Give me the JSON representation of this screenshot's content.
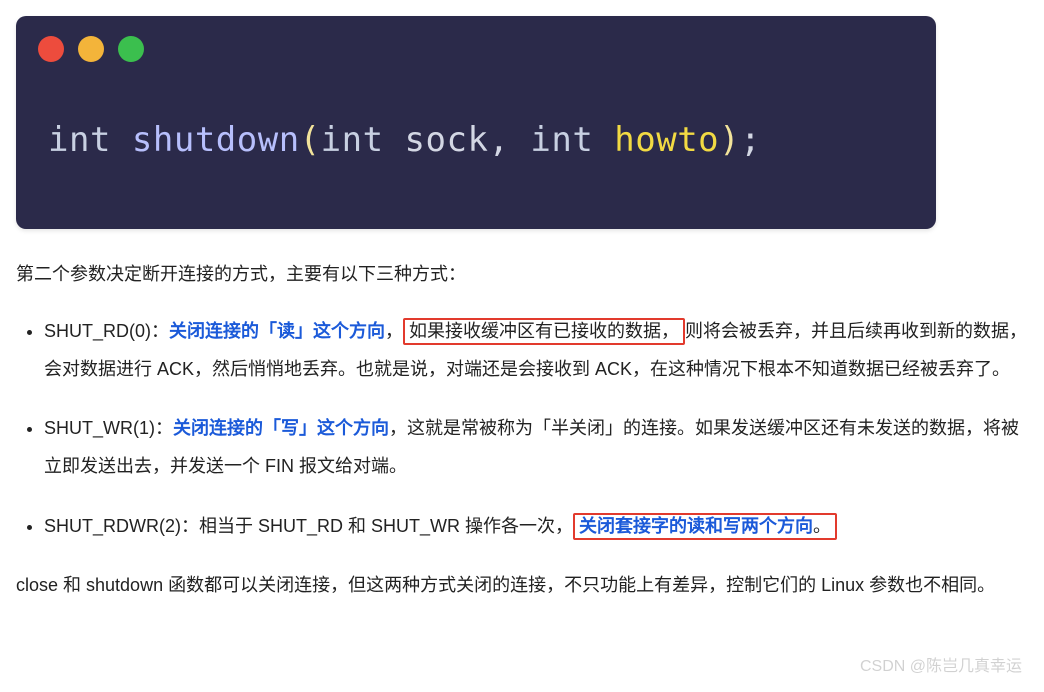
{
  "code": {
    "ret_type": "int",
    "space1": " ",
    "func": "shutdown",
    "paren_open": "(",
    "arg1_type": "int",
    "arg1_name": " sock",
    "comma": ", ",
    "arg2_type": "int",
    "arg2_name_pre": " ",
    "arg2_name": "howto",
    "paren_close": ")",
    "semi": ";"
  },
  "intro": "第二个参数决定断开连接的方式，主要有以下三种方式：",
  "bullets": [
    {
      "prefix": "SHUT_RD(0)：",
      "blue": "关闭连接的「读」这个方向",
      "after_blue": "，",
      "redbox": "如果接收缓冲区有已接收的数据，",
      "tail": "则将会被丢弃，并且后续再收到新的数据，会对数据进行 ACK，然后悄悄地丢弃。也就是说，对端还是会接收到 ACK，在这种情况下根本不知道数据已经被丢弃了。"
    },
    {
      "prefix": "SHUT_WR(1)：",
      "blue": "关闭连接的「写」这个方向",
      "after_blue": "，这就是常被称为「半关闭」的连接。如果发送缓冲区还有未发送的数据，将被立即发送出去，并发送一个 FIN 报文给对端。",
      "redbox": "",
      "tail": ""
    },
    {
      "prefix": "SHUT_RDWR(2)：相当于 SHUT_RD 和 SHUT_WR 操作各一次，",
      "blue": "",
      "after_blue": "",
      "redbox_blue": "关闭套接字的读和写两个方向",
      "redbox_tail": "。",
      "tail": ""
    }
  ],
  "outro": "close 和 shutdown 函数都可以关闭连接，但这两种方式关闭的连接，不只功能上有差异，控制它们的 Linux 参数也不相同。",
  "watermark": "CSDN @陈岂几真幸运"
}
